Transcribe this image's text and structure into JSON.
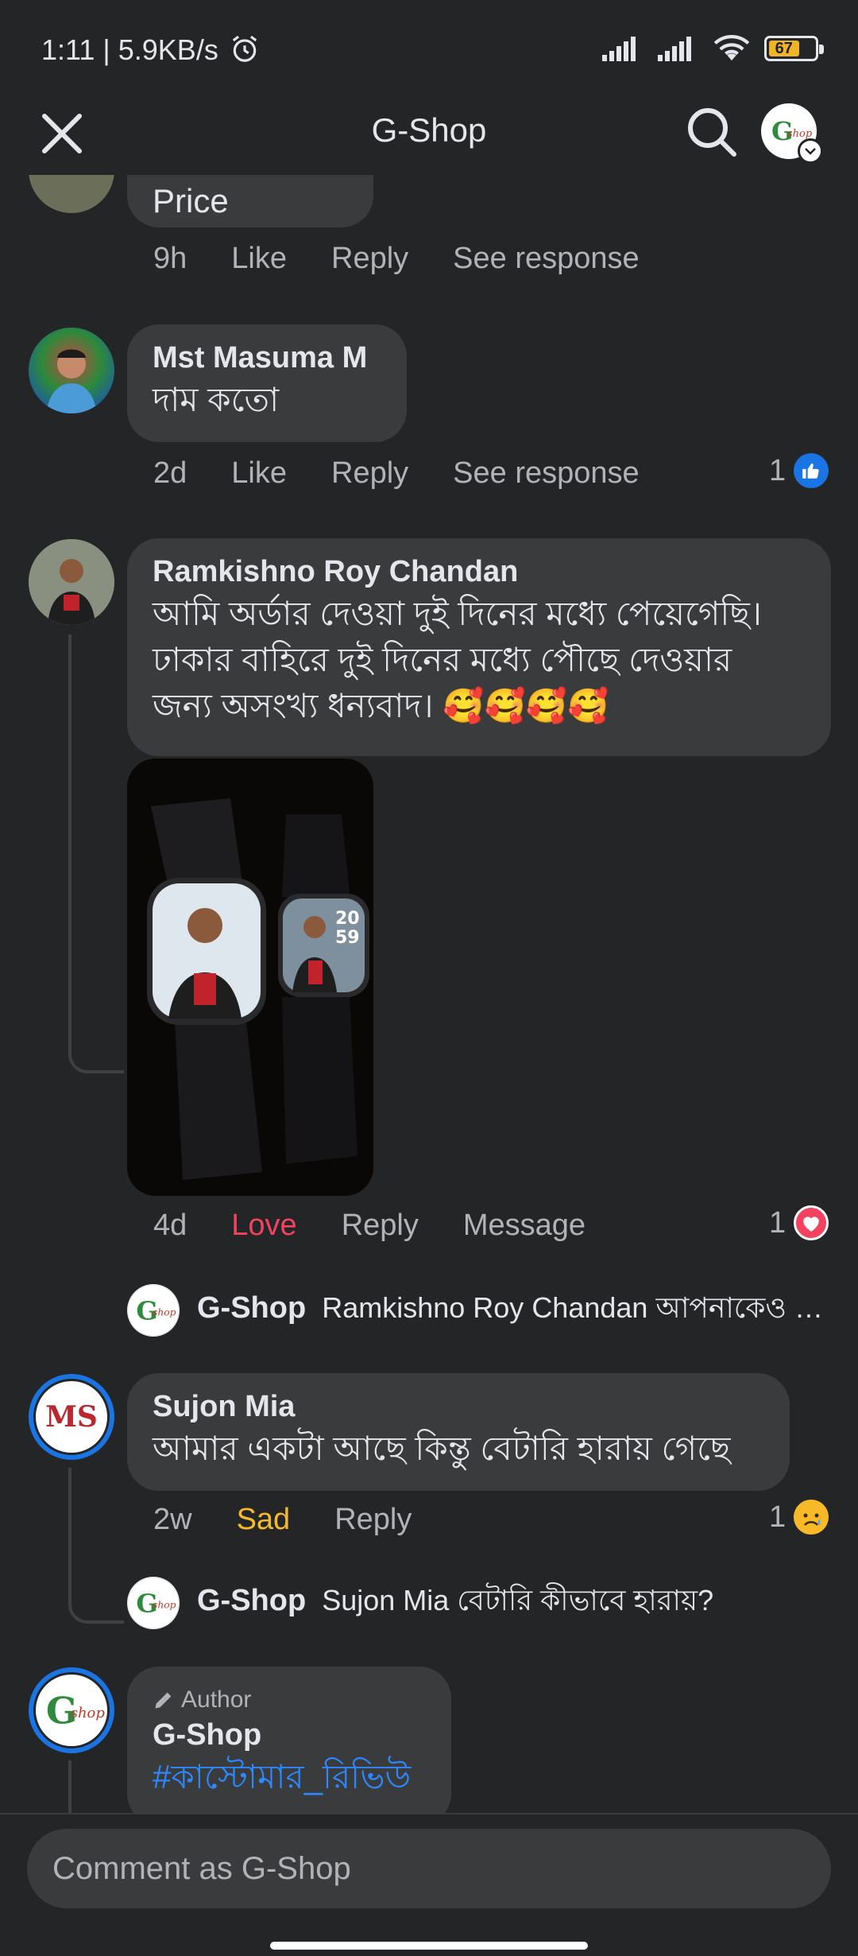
{
  "status": {
    "time": "1:11 | 5.9KB/s",
    "battery": "67"
  },
  "header": {
    "title": "G-Shop",
    "close_icon": "close-icon",
    "search_icon": "search-icon"
  },
  "comments": [
    {
      "text": "Price",
      "time": "9h",
      "actions": [
        "Like",
        "Reply",
        "See response"
      ]
    },
    {
      "name": "Mst Masuma M",
      "text": "দাম কতো",
      "time": "2d",
      "actions": [
        "Like",
        "Reply",
        "See response"
      ],
      "reaction_count": "1",
      "reaction": "like"
    },
    {
      "name": "Ramkishno Roy Chandan",
      "text_lines": [
        "আমি অর্ডার দেওয়া দুই দিনের মধ্যে পেয়েগেছি।",
        "ঢাকার বাহিরে দুই দিনের মধ্যে পৌছে দেওয়ার",
        "জন্য অসংখ্য ধন্যবাদ। 🥰🥰🥰🥰"
      ],
      "time": "4d",
      "actions": [
        "Love",
        "Reply",
        "Message"
      ],
      "reaction_count": "1",
      "reaction": "love",
      "watch_time": "20\n59",
      "reply": {
        "name": "G-Shop",
        "text": "Ramkishno Roy Chandan আপনাকেও অ..."
      }
    },
    {
      "name": "Sujon Mia",
      "avatar_text": "MS",
      "text": "আমার একটা আছে কিন্তু বেটারি হারায় গেছে",
      "time": "2w",
      "actions": [
        "Sad",
        "Reply"
      ],
      "reaction_count": "1",
      "reaction": "sad",
      "reply": {
        "name": "G-Shop",
        "text": "Sujon Mia বেটারি কীভাবে হারায়?"
      }
    },
    {
      "badge": "Author",
      "name": "G-Shop",
      "hashtag": "#কাস্টোমার_রিভিউ"
    }
  ],
  "logo": {
    "g": "G",
    "shop": "shop"
  },
  "composer": {
    "placeholder": "Comment as G-Shop"
  },
  "colors": {
    "background": "#242526",
    "bubble": "#3a3b3c",
    "love": "#f3425f",
    "sad": "#f7b928",
    "like": "#1b74e4",
    "hashtag": "#2d88ff"
  }
}
